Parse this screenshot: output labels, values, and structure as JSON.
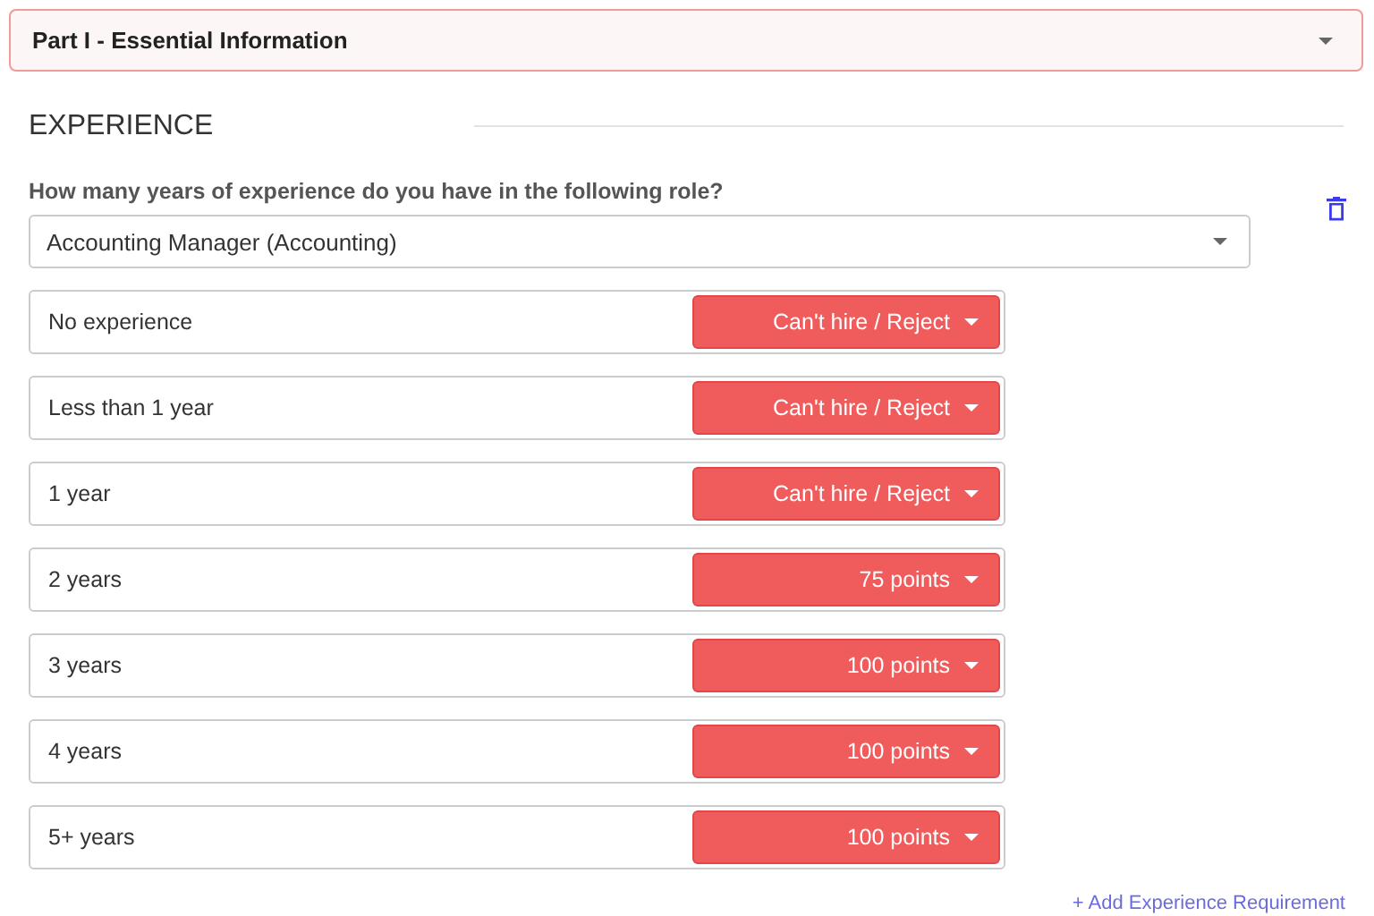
{
  "section_header": {
    "title": "Part I - Essential Information",
    "expanded": true
  },
  "heading": "EXPERIENCE",
  "question": "How many years of experience do you have in the following role?",
  "role_select": {
    "value": "Accounting Manager (Accounting)"
  },
  "rows": [
    {
      "label": "No experience",
      "score": "Can't hire / Reject"
    },
    {
      "label": "Less than 1 year",
      "score": "Can't hire / Reject"
    },
    {
      "label": "1 year",
      "score": "Can't hire / Reject"
    },
    {
      "label": "2 years",
      "score": "75 points"
    },
    {
      "label": "3 years",
      "score": "100 points"
    },
    {
      "label": "4 years",
      "score": "100 points"
    },
    {
      "label": "5+ years",
      "score": "100 points"
    }
  ],
  "add_link": "+ Add Experience Requirement"
}
